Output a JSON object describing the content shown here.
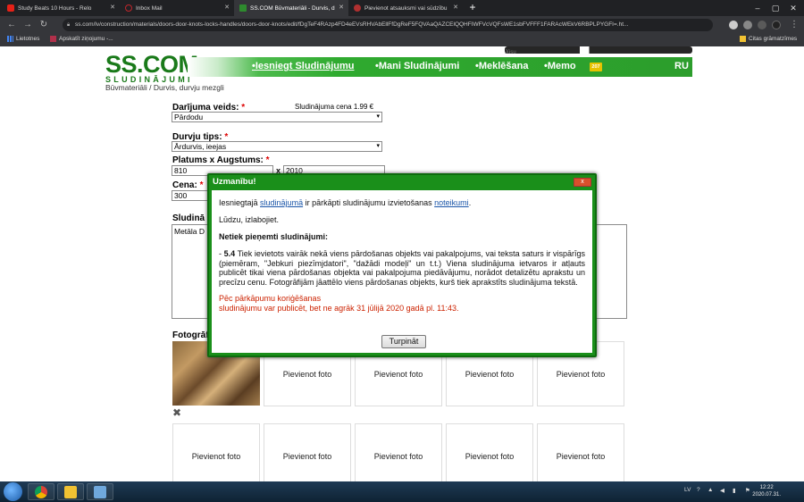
{
  "browser": {
    "tabs": [
      {
        "title": "Study Beats 10 Hours - Relo",
        "favicon_color": "#e62117"
      },
      {
        "title": "Inbox Mail",
        "favicon_color": "#c0262b"
      },
      {
        "title": "SS.COM Būvmateriāli - Durvis, d",
        "favicon_color": "#2e8b2e"
      },
      {
        "title": "Pievienot atsauksmi vai sūdzību",
        "favicon_color": "#b03030"
      }
    ],
    "url": "ss.com/lv/construction/materials/doors-door-knots-locks-handles/doors-door-knots/edit/fDgTeF4RAzp4FD4eEVsRHVAbEllFfDgReF5FQVAaQAZCElQQHFIWFVcVQFsWE1sbFVFFF1FARAcWEkV6RBPLPYGFI=.ht...",
    "bookmarks": [
      {
        "label": "Lietotnes"
      },
      {
        "label": "Apskatīt ziņojumu -..."
      },
      {
        "label": "Citas grāmatzīmes"
      }
    ]
  },
  "site": {
    "logo_big": "SS.COM",
    "logo_small": "SLUDINĀJUMI",
    "menu": [
      "•Iesniegt Sludinājumu",
      "•Mani Sludinājumi",
      "•Meklēšana",
      "•Memo"
    ],
    "badge": "207",
    "lang": "RU",
    "breadcrumb": "Būvmateriāli / Durvis, durvju mezgli",
    "user_partial": "Jūsu"
  },
  "form": {
    "deal_label": "Darījuma veids:",
    "deal_value": "Pārdodu",
    "price_note": "Sludinājuma cena 1.99 €",
    "door_type_label": "Durvju tips:",
    "door_type_value": "Ārdurvis, ieejas",
    "size_label": "Platums x Augstums:",
    "width": "810",
    "x_sep": "x",
    "height": "2010",
    "price_label": "Cena:",
    "price_value": "300",
    "text_label": "Sludinā",
    "text_value": "Metāla D",
    "photos_label": "Fotogrāf",
    "add_photo": "Pievienot foto",
    "req": "*"
  },
  "modal": {
    "title": "Uzmanību!",
    "close": "x",
    "line1_pre": "Iesniegtajā ",
    "line1_link1": "sludinājumā",
    "line1_mid": " ir pārkāpti sludinājumu izvietošanas ",
    "line1_link2": "noteikumi",
    "line1_post": ".",
    "apology": "Lūdzu, izlabojiet.",
    "heading": "Netiek pieņemti sludinājumi:",
    "rule_num": "5.4",
    "rule_prefix": "- ",
    "rule_text": " Tiek ievietots vairāk nekā viens pārdošanas objekts vai pakalpojums, vai teksta saturs ir vispārīgs (piemēram, \"Jebkuri piezīmjdatori\", \"dažādi modeļi\" un t.t.) Viena sludinājuma ietvaros ir atļauts publicēt tikai viena pārdošanas objekta vai pakalpojuma piedāvājumu, norādot detalizētu aprakstu un precīzu cenu. Fotogrāfijām jāattēlo viens pārdošanas objekts, kurš tiek aprakstīts sludinājuma tekstā.",
    "warn1": "Pēc pārkāpumu koriģēšanas",
    "warn2": "sludinājumu var publicēt, bet ne agrāk 31 jūlijā 2020 gadā pl. 11:43.",
    "button": "Turpināt"
  },
  "taskbar": {
    "lang": "LV",
    "time": "12:22",
    "date": "2020.07.31."
  }
}
